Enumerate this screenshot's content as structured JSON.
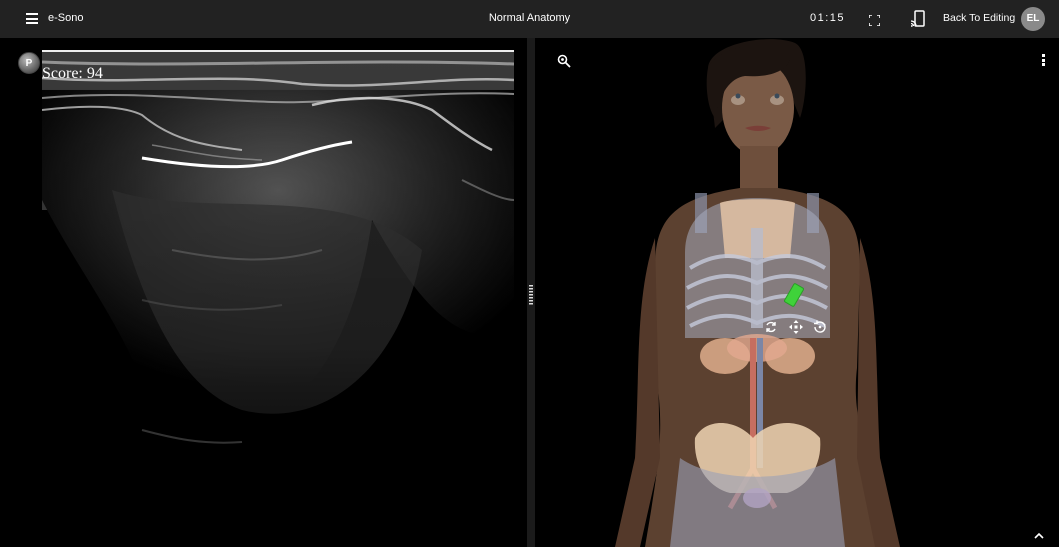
{
  "topbar": {
    "menu_icon": "hamburger-menu-icon",
    "app_name": "e-Sono",
    "page_title": "Normal Anatomy",
    "timer": "01:15",
    "fullscreen_icon": "fullscreen-icon",
    "cast_icon": "cast-icon",
    "back_button_label": "Back To Editing",
    "avatar_initials": "EL",
    "background_color": "#222222"
  },
  "ultrasound": {
    "badge_label": "P",
    "score_text": "Score: 94"
  },
  "viewer": {
    "zoom_icon": "zoom-in-icon",
    "more_icon": "more-vert-icon",
    "probe_color": "#3fd23a",
    "controls": [
      {
        "name": "rotate-icon"
      },
      {
        "name": "move-icon"
      },
      {
        "name": "reset-icon"
      }
    ],
    "collapse_icon": "chevron-up-icon"
  }
}
